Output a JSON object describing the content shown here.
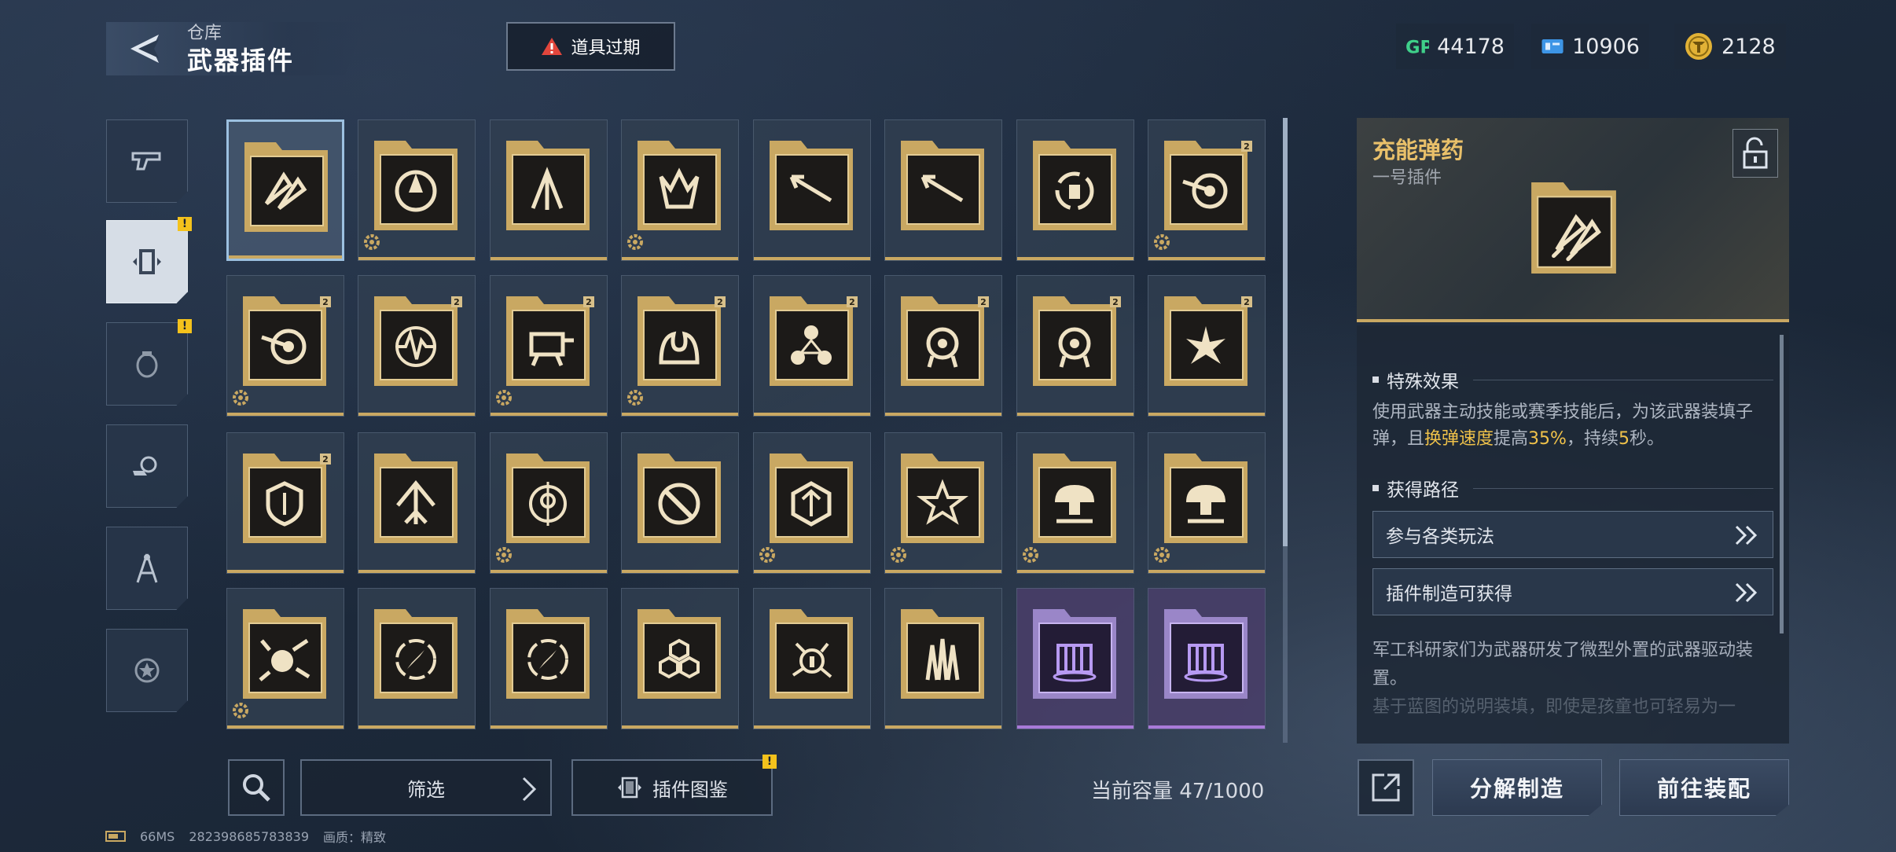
{
  "header": {
    "breadcrumb": "仓库",
    "title": "武器插件",
    "expire_label": "道具过期"
  },
  "currencies": [
    {
      "icon": "gp-icon",
      "value": "44178"
    },
    {
      "icon": "ticket-icon",
      "value": "10906"
    },
    {
      "icon": "coin-icon",
      "value": "2128"
    }
  ],
  "categories": [
    {
      "icon": "pistol-icon",
      "active": false,
      "badge": false
    },
    {
      "icon": "plugin-icon",
      "active": true,
      "badge": true
    },
    {
      "icon": "grenade-icon",
      "active": false,
      "badge": true
    },
    {
      "icon": "gear-hand-icon",
      "active": false,
      "badge": false
    },
    {
      "icon": "compass-icon",
      "active": false,
      "badge": false
    },
    {
      "icon": "star-gear-icon",
      "active": false,
      "badge": false
    }
  ],
  "badge_mark": "!",
  "grid": {
    "items": [
      {
        "glyph": "rockets",
        "rarity": "gold",
        "selected": true,
        "lvl": "",
        "gear": false
      },
      {
        "glyph": "vortex",
        "rarity": "gold",
        "lvl": "",
        "gear": true
      },
      {
        "glyph": "arrows-up",
        "rarity": "gold",
        "lvl": "",
        "gear": false
      },
      {
        "glyph": "crown-arrow",
        "rarity": "gold",
        "lvl": "",
        "gear": true
      },
      {
        "glyph": "arrow-dash",
        "rarity": "gold",
        "lvl": "",
        "gear": false
      },
      {
        "glyph": "arrow-dash",
        "rarity": "gold",
        "lvl": "",
        "gear": false
      },
      {
        "glyph": "reload",
        "rarity": "gold",
        "lvl": "",
        "gear": false
      },
      {
        "glyph": "target-arrow",
        "rarity": "gold",
        "lvl": "2",
        "gear": true
      },
      {
        "glyph": "target-arrow",
        "rarity": "gold",
        "lvl": "2",
        "gear": true
      },
      {
        "glyph": "pulse",
        "rarity": "gold",
        "lvl": "2",
        "gear": false
      },
      {
        "glyph": "turret",
        "rarity": "gold",
        "lvl": "2",
        "gear": true
      },
      {
        "glyph": "fountain",
        "rarity": "gold",
        "lvl": "2",
        "gear": true
      },
      {
        "glyph": "triangle-orbs",
        "rarity": "gold",
        "lvl": "2",
        "gear": false
      },
      {
        "glyph": "drone",
        "rarity": "gold",
        "lvl": "2",
        "gear": false
      },
      {
        "glyph": "drone",
        "rarity": "gold",
        "lvl": "2",
        "gear": false
      },
      {
        "glyph": "burst",
        "rarity": "gold",
        "lvl": "2",
        "gear": false
      },
      {
        "glyph": "shield-vortex",
        "rarity": "gold",
        "lvl": "2",
        "gear": false
      },
      {
        "glyph": "up-arrow",
        "rarity": "gold",
        "lvl": "",
        "gear": false
      },
      {
        "glyph": "crosshair",
        "rarity": "gold",
        "lvl": "",
        "gear": true
      },
      {
        "glyph": "slash-circle",
        "rarity": "gold",
        "lvl": "",
        "gear": false
      },
      {
        "glyph": "hex-arrow",
        "rarity": "gold",
        "lvl": "",
        "gear": true
      },
      {
        "glyph": "star-arrow",
        "rarity": "gold",
        "lvl": "",
        "gear": true
      },
      {
        "glyph": "mushroom",
        "rarity": "gold",
        "lvl": "",
        "gear": true
      },
      {
        "glyph": "mushroom",
        "rarity": "gold",
        "lvl": "",
        "gear": true
      },
      {
        "glyph": "explosion",
        "rarity": "gold",
        "lvl": "",
        "gear": true
      },
      {
        "glyph": "compass",
        "rarity": "gold",
        "lvl": "",
        "gear": false
      },
      {
        "glyph": "compass",
        "rarity": "gold",
        "lvl": "",
        "gear": false
      },
      {
        "glyph": "hexagons",
        "rarity": "gold",
        "lvl": "",
        "gear": false
      },
      {
        "glyph": "info-burst",
        "rarity": "gold",
        "lvl": "",
        "gear": false
      },
      {
        "glyph": "spikes",
        "rarity": "gold",
        "lvl": "",
        "gear": false
      },
      {
        "glyph": "waterfall",
        "rarity": "purple",
        "lvl": "",
        "gear": false
      },
      {
        "glyph": "waterfall",
        "rarity": "purple",
        "lvl": "",
        "gear": false
      }
    ]
  },
  "bottom": {
    "filter_label": "筛选",
    "atlas_label": "插件图鉴",
    "capacity_text": "当前容量 47/1000"
  },
  "status": {
    "latency": "66MS",
    "uid": "282398685783839",
    "quality": "画质：精致"
  },
  "detail": {
    "name": "充能弹药",
    "subtitle": "一号插件",
    "effect_title": "特殊效果",
    "effect_pre": "使用武器主动技能或赛季技能后，为该武器装填子弹，且",
    "effect_hl1": "换弹速度",
    "effect_mid": "提高",
    "effect_hl2": "35%",
    "effect_mid2": "，持续",
    "effect_hl3": "5",
    "effect_post": "秒。",
    "source_title": "获得路径",
    "routes": [
      "参与各类玩法",
      "插件制造可获得"
    ],
    "lore_line1": "军工科研家们为武器研发了微型外置的武器驱动装置。",
    "lore_line2": "基于蓝图的说明装填，即使是孩童也可轻易为一"
  },
  "actions": {
    "decompose_label": "分解制造",
    "equip_label": "前往装配"
  },
  "colors": {
    "gold": "#c9a862",
    "highlight": "#f0c24a",
    "purple": "#a97ad8",
    "warning": "#e2463c"
  }
}
